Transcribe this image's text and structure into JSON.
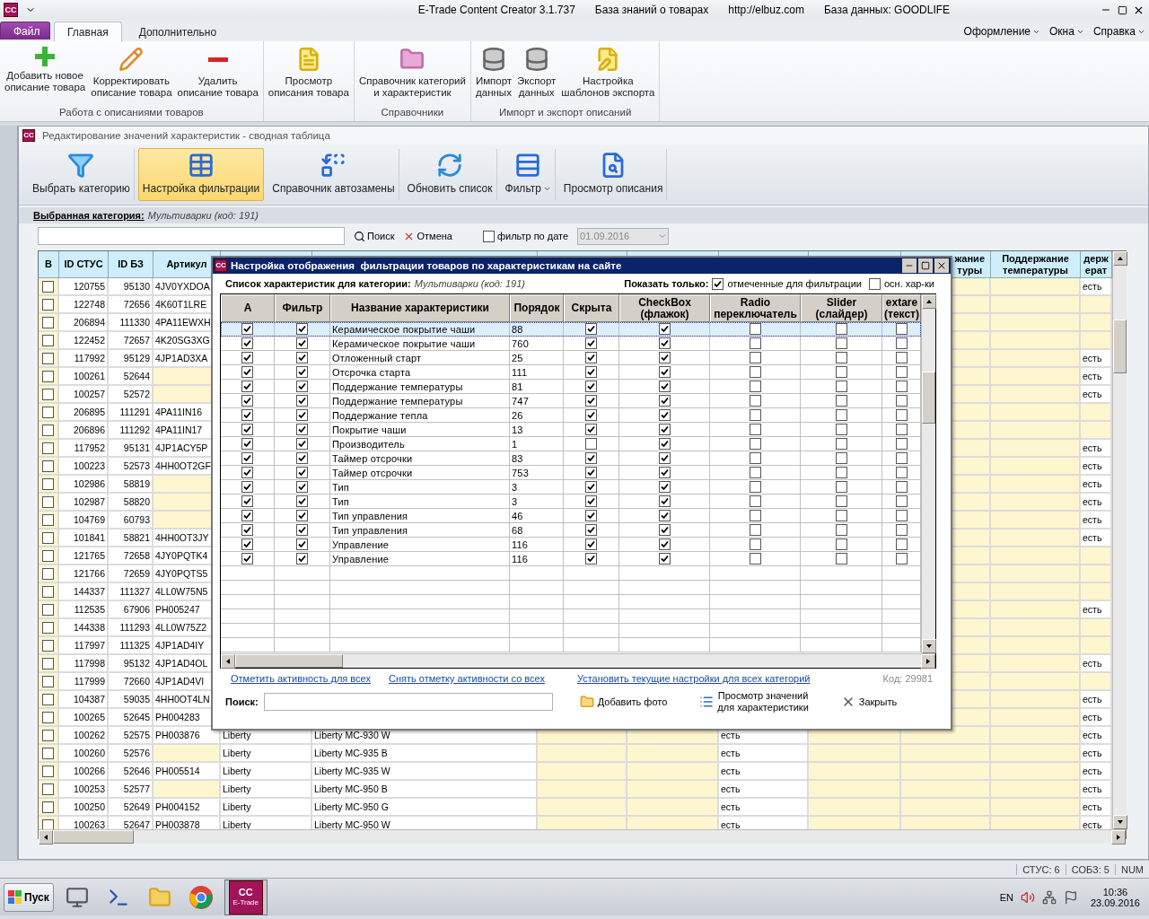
{
  "window": {
    "logo": "CC",
    "title": "E-Trade Content Creator 3.1.737",
    "info": [
      "База знаний о товарах",
      "http://elbuz.com",
      "База данных: GOODLIFE"
    ]
  },
  "menu": {
    "tabs": [
      {
        "label": "Файл",
        "kind": "file",
        "selected": false
      },
      {
        "label": "Главная",
        "kind": "tab",
        "selected": true
      },
      {
        "label": "Дополнительно",
        "kind": "tab",
        "selected": false
      }
    ],
    "right": [
      "Оформление",
      "Окна",
      "Справка"
    ]
  },
  "ribbon": {
    "groups": [
      {
        "label": "Работа с описаниями товаров",
        "buttons": [
          {
            "label": "Добавить новое\nописание товара"
          },
          {
            "label": "Корректировать\nописание товара"
          },
          {
            "label": "Удалить\nописание товара"
          }
        ]
      },
      {
        "buttons": [
          {
            "label": "Просмотр\nописания товара"
          }
        ]
      },
      {
        "label": "Справочники",
        "buttons": [
          {
            "label": "Справочник категорий\nи характеристик"
          }
        ]
      },
      {
        "label": "Импорт и экспорт описаний",
        "buttons": [
          {
            "label": "Импорт\nданных"
          },
          {
            "label": "Экспорт\nданных"
          },
          {
            "label": "Настройка\nшаблонов экспорта"
          }
        ]
      }
    ]
  },
  "child": {
    "logo": "CC",
    "title": "Редактирование значений характеристик - сводная таблица",
    "toolbar": [
      {
        "label": "Выбрать категорию",
        "selected": false,
        "dropdown": false
      },
      {
        "label": "Настройка фильтрации",
        "selected": true,
        "dropdown": false
      },
      {
        "label": "Справочник автозамены",
        "selected": false,
        "dropdown": false
      },
      {
        "label": "Обновить список",
        "selected": false,
        "dropdown": false
      },
      {
        "label": "Фильтр",
        "selected": false,
        "dropdown": true
      },
      {
        "label": "Просмотр описания",
        "selected": false,
        "dropdown": false
      }
    ],
    "category": {
      "label": "Выбранная категория:",
      "value": "Мультиварки (код: 191)"
    },
    "search": {
      "button": "Поиск",
      "cancel": "Отмена",
      "date_filter": {
        "label": "фильтр по дате",
        "checked": false,
        "value": "01.09.2016",
        "disabled": true
      }
    },
    "table": {
      "checkbox_column": "B",
      "columns": [
        "ID СТУС",
        "ID БЗ",
        "Артикул",
        null,
        null,
        null,
        null,
        null,
        null,
        "жание\nтуры",
        "Поддержание\nтемпературы",
        "держ\nерат"
      ],
      "rows": [
        {
          "checked": false,
          "cells": [
            "120755",
            "95130",
            "4JV0YXDOA",
            null,
            null,
            null,
            null,
            null,
            null,
            null,
            null,
            "есть"
          ]
        },
        {
          "checked": false,
          "cells": [
            "122748",
            "72656",
            "4K60T1LRE",
            null,
            null,
            null,
            null,
            null,
            null,
            null,
            null,
            null
          ]
        },
        {
          "checked": false,
          "cells": [
            "206894",
            "111330",
            "4PA11EWXH",
            null,
            null,
            null,
            null,
            null,
            null,
            null,
            null,
            null
          ]
        },
        {
          "checked": false,
          "cells": [
            "122452",
            "72657",
            "4K20SG3XG",
            null,
            null,
            null,
            null,
            null,
            null,
            null,
            null,
            null
          ]
        },
        {
          "checked": false,
          "cells": [
            "117992",
            "95129",
            "4JP1AD3XA",
            null,
            null,
            null,
            null,
            null,
            null,
            null,
            null,
            "есть"
          ]
        },
        {
          "checked": false,
          "cells": [
            "100261",
            "52644",
            null,
            null,
            null,
            null,
            null,
            null,
            null,
            null,
            null,
            "есть"
          ]
        },
        {
          "checked": false,
          "cells": [
            "100257",
            "52572",
            null,
            null,
            null,
            null,
            null,
            null,
            null,
            null,
            null,
            "есть"
          ]
        },
        {
          "checked": false,
          "cells": [
            "206895",
            "111291",
            "4PA11IN16",
            null,
            null,
            null,
            null,
            null,
            null,
            null,
            null,
            null
          ]
        },
        {
          "checked": false,
          "cells": [
            "206896",
            "111292",
            "4PA11IN17",
            null,
            null,
            null,
            null,
            null,
            null,
            null,
            null,
            null
          ]
        },
        {
          "checked": false,
          "cells": [
            "117952",
            "95131",
            "4JP1ACY5P",
            null,
            null,
            null,
            null,
            null,
            null,
            null,
            null,
            "есть"
          ]
        },
        {
          "checked": false,
          "cells": [
            "100223",
            "52573",
            "4HH0OT2GF",
            null,
            null,
            null,
            null,
            null,
            null,
            null,
            null,
            "есть"
          ]
        },
        {
          "checked": false,
          "cells": [
            "102986",
            "58819",
            null,
            null,
            null,
            null,
            null,
            null,
            null,
            null,
            null,
            "есть"
          ]
        },
        {
          "checked": false,
          "cells": [
            "102987",
            "58820",
            null,
            null,
            null,
            null,
            null,
            null,
            null,
            null,
            null,
            "есть"
          ]
        },
        {
          "checked": false,
          "cells": [
            "104769",
            "60793",
            null,
            null,
            null,
            null,
            null,
            null,
            null,
            null,
            null,
            "есть"
          ]
        },
        {
          "checked": false,
          "cells": [
            "101841",
            "58821",
            "4HH0OT3JY",
            null,
            null,
            null,
            null,
            null,
            null,
            null,
            null,
            "есть"
          ]
        },
        {
          "checked": false,
          "cells": [
            "121765",
            "72658",
            "4JY0PQTK4",
            null,
            null,
            null,
            null,
            null,
            null,
            null,
            null,
            null
          ]
        },
        {
          "checked": false,
          "cells": [
            "121766",
            "72659",
            "4JY0PQTS5",
            null,
            null,
            null,
            null,
            null,
            null,
            null,
            null,
            null
          ]
        },
        {
          "checked": false,
          "cells": [
            "144337",
            "111327",
            "4LL0W75N5",
            null,
            null,
            null,
            null,
            null,
            null,
            null,
            null,
            null
          ]
        },
        {
          "checked": false,
          "cells": [
            "112535",
            "67906",
            "PH005247",
            null,
            null,
            null,
            null,
            null,
            null,
            null,
            null,
            "есть"
          ]
        },
        {
          "checked": false,
          "cells": [
            "144338",
            "111293",
            "4LL0W75Z2",
            null,
            null,
            null,
            null,
            null,
            null,
            null,
            null,
            null
          ]
        },
        {
          "checked": false,
          "cells": [
            "117997",
            "111325",
            "4JP1AD4IY",
            null,
            null,
            null,
            null,
            null,
            null,
            null,
            null,
            null
          ]
        },
        {
          "checked": false,
          "cells": [
            "117998",
            "95132",
            "4JP1AD4OL",
            null,
            null,
            null,
            null,
            null,
            null,
            null,
            null,
            "есть"
          ]
        },
        {
          "checked": false,
          "cells": [
            "117999",
            "72660",
            "4JP1AD4VI",
            null,
            null,
            null,
            null,
            null,
            null,
            null,
            null,
            null
          ]
        },
        {
          "checked": false,
          "cells": [
            "104387",
            "59035",
            "4HH0OT4LN",
            null,
            null,
            null,
            null,
            null,
            null,
            null,
            null,
            "есть"
          ]
        },
        {
          "checked": false,
          "cells": [
            "100265",
            "52645",
            "PH004283",
            null,
            null,
            null,
            null,
            null,
            null,
            null,
            null,
            "есть"
          ]
        },
        {
          "checked": false,
          "cells": [
            "100262",
            "52575",
            "PH003876",
            "Liberty",
            "Liberty MC-930 W",
            null,
            null,
            "есть",
            null,
            null,
            null,
            "есть"
          ]
        },
        {
          "checked": false,
          "cells": [
            "100260",
            "52576",
            null,
            "Liberty",
            "Liberty MC-935 B",
            null,
            null,
            "есть",
            null,
            null,
            null,
            "есть"
          ]
        },
        {
          "checked": false,
          "cells": [
            "100266",
            "52646",
            "PH005514",
            "Liberty",
            "Liberty MC-935 W",
            null,
            null,
            "есть",
            null,
            null,
            null,
            "есть"
          ]
        },
        {
          "checked": false,
          "cells": [
            "100253",
            "52577",
            null,
            "Liberty",
            "Liberty MC-950 B",
            null,
            null,
            "есть",
            null,
            null,
            null,
            "есть"
          ]
        },
        {
          "checked": false,
          "cells": [
            "100250",
            "52649",
            "PH004152",
            "Liberty",
            "Liberty MC-950 G",
            null,
            null,
            "есть",
            null,
            null,
            null,
            "есть"
          ]
        },
        {
          "checked": false,
          "cells": [
            "100263",
            "52647",
            "PH003878",
            "Liberty",
            "Liberty MC-950 W",
            null,
            null,
            "есть",
            null,
            null,
            null,
            "есть"
          ]
        }
      ]
    }
  },
  "dialog": {
    "logo": "CC",
    "title": "Настройка отображения  фильтрации товаров по характеристикам на сайте",
    "category_label": "Список характеристик для категории:",
    "category_value": "Мультиварки (код: 191)",
    "show_only": {
      "label": "Показать только:",
      "options": [
        {
          "label": "отмеченные для фильтрации",
          "checked": true
        },
        {
          "label": "осн. хар-ки",
          "checked": false
        }
      ]
    },
    "columns": [
      "A",
      "Фильтр",
      "Название характеристики",
      "Порядок",
      "Скрыта",
      "CheckBox\n(флажок)",
      "Radio\nпереключатель",
      "Slider\n(слайдер)",
      "extare\n(текст)"
    ],
    "rows": [
      {
        "selected": true,
        "active": true,
        "filter": true,
        "name": "Керамическое покрытие чаши",
        "order": "88",
        "hidden": true,
        "checkbox": true,
        "radio": false,
        "slider": false,
        "text": false
      },
      {
        "selected": false,
        "active": true,
        "filter": true,
        "name": "Керамическое покрытие чаши",
        "order": "760",
        "hidden": true,
        "checkbox": true,
        "radio": false,
        "slider": false,
        "text": false
      },
      {
        "selected": false,
        "active": true,
        "filter": true,
        "name": "Отложенный старт",
        "order": "25",
        "hidden": true,
        "checkbox": true,
        "radio": false,
        "slider": false,
        "text": false
      },
      {
        "selected": false,
        "active": true,
        "filter": true,
        "name": "Отсрочка старта",
        "order": "111",
        "hidden": true,
        "checkbox": true,
        "radio": false,
        "slider": false,
        "text": false
      },
      {
        "selected": false,
        "active": true,
        "filter": true,
        "name": "Поддержание температуры",
        "order": "81",
        "hidden": true,
        "checkbox": true,
        "radio": false,
        "slider": false,
        "text": false
      },
      {
        "selected": false,
        "active": true,
        "filter": true,
        "name": "Поддержание температуры",
        "order": "747",
        "hidden": true,
        "checkbox": true,
        "radio": false,
        "slider": false,
        "text": false
      },
      {
        "selected": false,
        "active": true,
        "filter": true,
        "name": "Поддержание тепла",
        "order": "26",
        "hidden": true,
        "checkbox": true,
        "radio": false,
        "slider": false,
        "text": false
      },
      {
        "selected": false,
        "active": true,
        "filter": true,
        "name": "Покрытие чаши",
        "order": "13",
        "hidden": true,
        "checkbox": true,
        "radio": false,
        "slider": false,
        "text": false
      },
      {
        "selected": false,
        "active": true,
        "filter": true,
        "name": "Производитель",
        "order": "1",
        "hidden": false,
        "checkbox": true,
        "radio": false,
        "slider": false,
        "text": false
      },
      {
        "selected": false,
        "active": true,
        "filter": true,
        "name": "Таймер отсрочки",
        "order": "83",
        "hidden": true,
        "checkbox": true,
        "radio": false,
        "slider": false,
        "text": false
      },
      {
        "selected": false,
        "active": true,
        "filter": true,
        "name": "Таймер отсрочки",
        "order": "753",
        "hidden": true,
        "checkbox": true,
        "radio": false,
        "slider": false,
        "text": false
      },
      {
        "selected": false,
        "active": true,
        "filter": true,
        "name": "Тип",
        "order": "3",
        "hidden": true,
        "checkbox": true,
        "radio": false,
        "slider": false,
        "text": false
      },
      {
        "selected": false,
        "active": true,
        "filter": true,
        "name": "Тип",
        "order": "3",
        "hidden": true,
        "checkbox": true,
        "radio": false,
        "slider": false,
        "text": false
      },
      {
        "selected": false,
        "active": true,
        "filter": true,
        "name": "Тип управления",
        "order": "46",
        "hidden": true,
        "checkbox": true,
        "radio": false,
        "slider": false,
        "text": false
      },
      {
        "selected": false,
        "active": true,
        "filter": true,
        "name": "Тип управления",
        "order": "68",
        "hidden": true,
        "checkbox": true,
        "radio": false,
        "slider": false,
        "text": false
      },
      {
        "selected": false,
        "active": true,
        "filter": true,
        "name": "Управление",
        "order": "116",
        "hidden": true,
        "checkbox": true,
        "radio": false,
        "slider": false,
        "text": false
      },
      {
        "selected": false,
        "active": true,
        "filter": true,
        "name": "Управление",
        "order": "116",
        "hidden": true,
        "checkbox": true,
        "radio": false,
        "slider": false,
        "text": false
      }
    ],
    "links": [
      "Отметить активность для всех",
      "Снять отметку активности со всех",
      "Установить текущие настройки для всех категорий"
    ],
    "code": "Код: 29981",
    "search_label": "Поиск:",
    "buttons": [
      {
        "label": "Добавить фото"
      },
      {
        "label": "Просмотр значений\nдля характеристики"
      },
      {
        "label": "Закрыть"
      }
    ]
  },
  "status_bar": [
    "СТУС: 6",
    "СОБЗ: 5",
    "NUM"
  ],
  "taskbar": {
    "start": "Пуск",
    "app": {
      "logo": "CC",
      "label": "E-Trade"
    },
    "language": "EN",
    "time": "10:36",
    "date": "23.09.2016"
  }
}
